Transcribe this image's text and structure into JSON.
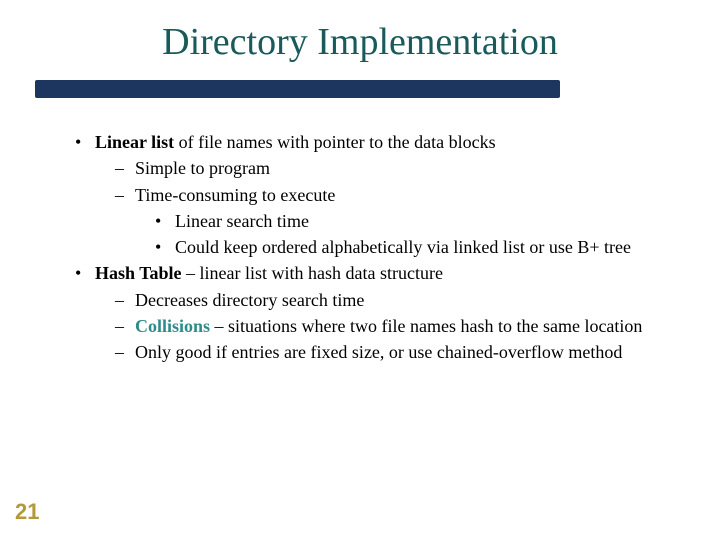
{
  "title": "Directory Implementation",
  "bullets": {
    "b1_strong": "Linear list",
    "b1_rest": " of file names with pointer to the data blocks",
    "b1a": "Simple to program",
    "b1b": "Time-consuming to execute",
    "b1b1": "Linear search time",
    "b1b2": "Could keep ordered alphabetically via linked list or use B+ tree",
    "b2_strong": "Hash Table",
    "b2_rest": " – linear list with hash data structure",
    "b2a": "Decreases directory search time",
    "b2b_term": "Collisions",
    "b2b_rest": " – situations where two file names hash to the same location",
    "b2c": "Only good if entries are fixed size, or use chained-overflow method"
  },
  "slide_number": "21"
}
